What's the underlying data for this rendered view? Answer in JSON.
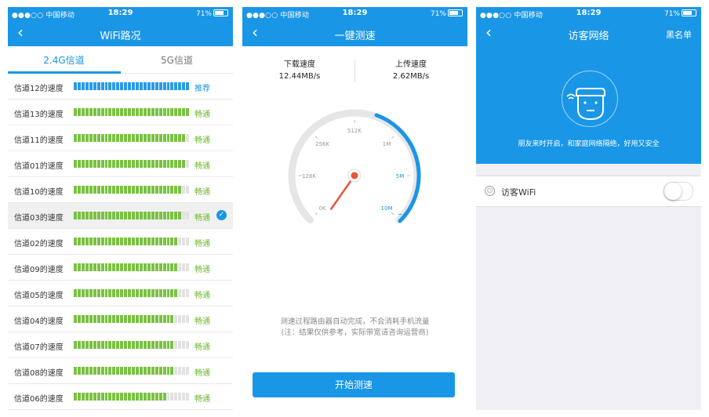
{
  "status_bar": {
    "carrier": "●●●○○ 中国移动",
    "wifi_icon": "wifi-icon",
    "time": "18:29",
    "battery": "71%"
  },
  "screen1": {
    "title": "WiFi路况",
    "tabs": [
      "2.4G信道",
      "5G信道"
    ],
    "rows": [
      {
        "name": "信道12的速度",
        "fill": 1.0,
        "status": "推荐",
        "color": "#2a9ae8",
        "selected": false
      },
      {
        "name": "信道13的速度",
        "fill": 1.0,
        "status": "畅通",
        "color": "#7ac142",
        "selected": false
      },
      {
        "name": "信道11的速度",
        "fill": 0.97,
        "status": "畅通",
        "color": "#7ac142",
        "selected": false
      },
      {
        "name": "信道01的速度",
        "fill": 0.97,
        "status": "畅通",
        "color": "#7ac142",
        "selected": false
      },
      {
        "name": "信道10的速度",
        "fill": 0.93,
        "status": "畅通",
        "color": "#7ac142",
        "selected": false
      },
      {
        "name": "信道03的速度",
        "fill": 0.93,
        "status": "畅通",
        "color": "#7ac142",
        "selected": true
      },
      {
        "name": "信道02的速度",
        "fill": 0.9,
        "status": "畅通",
        "color": "#7ac142",
        "selected": false
      },
      {
        "name": "信道09的速度",
        "fill": 0.9,
        "status": "畅通",
        "color": "#7ac142",
        "selected": false
      },
      {
        "name": "信道05的速度",
        "fill": 0.9,
        "status": "畅通",
        "color": "#7ac142",
        "selected": false
      },
      {
        "name": "信道04的速度",
        "fill": 0.87,
        "status": "畅通",
        "color": "#7ac142",
        "selected": false
      },
      {
        "name": "信道07的速度",
        "fill": 0.87,
        "status": "畅通",
        "color": "#7ac142",
        "selected": false
      },
      {
        "name": "信道08的速度",
        "fill": 0.87,
        "status": "畅通",
        "color": "#7ac142",
        "selected": false
      },
      {
        "name": "信道06的速度",
        "fill": 0.8,
        "status": "畅通",
        "color": "#7ac142",
        "selected": false
      }
    ]
  },
  "screen2": {
    "title": "一键测速",
    "download_label": "下载速度",
    "download_value": "12.44MB/s",
    "upload_label": "上传速度",
    "upload_value": "2.62MB/s",
    "gauge_ticks": [
      "0K",
      "128K",
      "256K",
      "512K",
      "1M",
      "5M",
      "10M"
    ],
    "gauge_more": "~",
    "gauge_fill": 0.4,
    "note_line1": "测速过程路由器自动完成，不会消耗手机流量",
    "note_line2": "(注：结果仅供参考，实际带宽请咨询运营商)",
    "start_button": "开始测速"
  },
  "screen3": {
    "title": "访客网络",
    "right_action": "黑名单",
    "description": "朋友来时开启，和家庭网络隔绝，好用又安全",
    "guest_label": "访客WiFi",
    "guest_enabled": false
  },
  "colors": {
    "primary": "#1a96e6",
    "good": "#7ac142",
    "status_text": "#6dba2c"
  }
}
